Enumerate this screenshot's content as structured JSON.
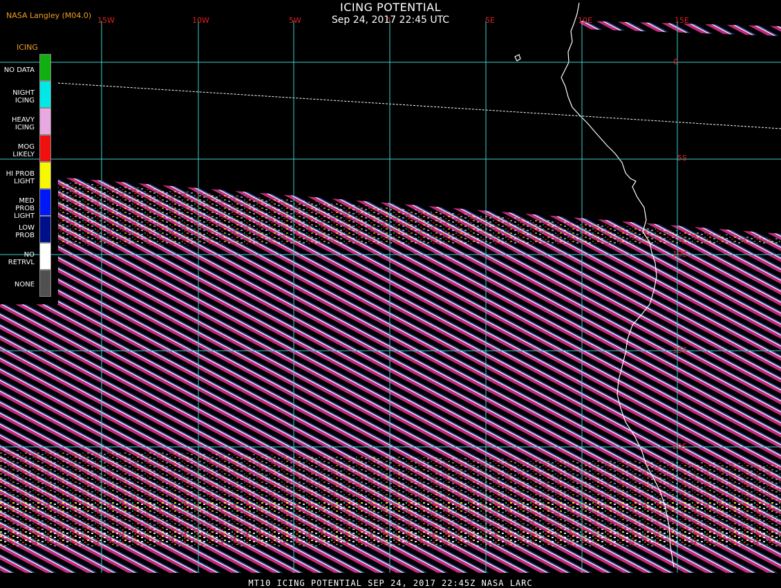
{
  "header": {
    "title": "ICING POTENTIAL",
    "subtitle": "Sep 24, 2017 22:45 UTC",
    "producer": "NASA Langley (M04.0)"
  },
  "footer": {
    "caption": "MT10  ICING POTENTIAL  SEP 24, 2017 22:45Z  NASA LARC"
  },
  "legend": {
    "title": "ICING",
    "items": [
      {
        "label": "NO DATA",
        "color": "#10b010"
      },
      {
        "label": "NIGHT\nICING",
        "color": "#00e8e8"
      },
      {
        "label": "HEAVY\nICING",
        "color": "#e8a8e0"
      },
      {
        "label": "MOG\nLIKELY",
        "color": "#f01010"
      },
      {
        "label": "HI PROB\nLIGHT",
        "color": "#f8f800"
      },
      {
        "label": "MED PROB\nLIGHT",
        "color": "#0018f8"
      },
      {
        "label": "LOW\nPROB",
        "color": "#00108a"
      },
      {
        "label": "NO\nRETRVL",
        "color": "#ffffff"
      },
      {
        "label": "NONE",
        "color": "#505050"
      }
    ]
  },
  "grid": {
    "color": "#40d0d0",
    "longitude_labels": [
      "15W",
      "10W",
      "5W",
      "0",
      "5E",
      "10E",
      "15E"
    ],
    "latitude_labels": [
      "0",
      "5S",
      "10S",
      "15S",
      "20S"
    ]
  },
  "map": {
    "background": "#000000",
    "coastline_color": "#ffffff",
    "swath_color": "#cc2e86",
    "visible_lon_labels_note": ""
  }
}
